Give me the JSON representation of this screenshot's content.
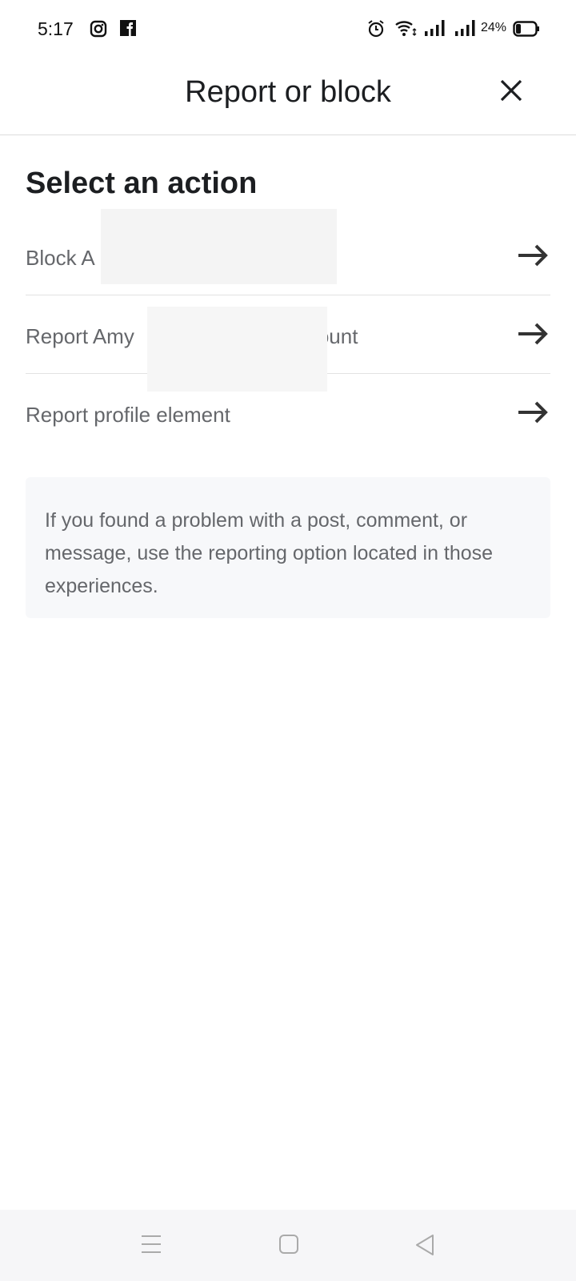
{
  "status_bar": {
    "time": "5:17",
    "battery": "24%",
    "icons": [
      "instagram-icon",
      "facebook-icon",
      "alarm-icon",
      "wifi-icon",
      "signal-icon",
      "signal-icon",
      "battery-icon"
    ]
  },
  "header": {
    "title": "Report or block",
    "close_icon": "close-icon"
  },
  "section_title": "Select an action",
  "actions": [
    {
      "label": "Block A",
      "suffix": ""
    },
    {
      "label": "Report Amy",
      "suffix": "count"
    },
    {
      "label": "Report profile element",
      "suffix": ""
    }
  ],
  "info_text": "If you found a problem with a post, comment, or message, use the reporting option located in those experiences.",
  "colors": {
    "primary_text": "#1c1e21",
    "secondary_text": "#65676b",
    "info_bg": "#f7f8fa"
  }
}
